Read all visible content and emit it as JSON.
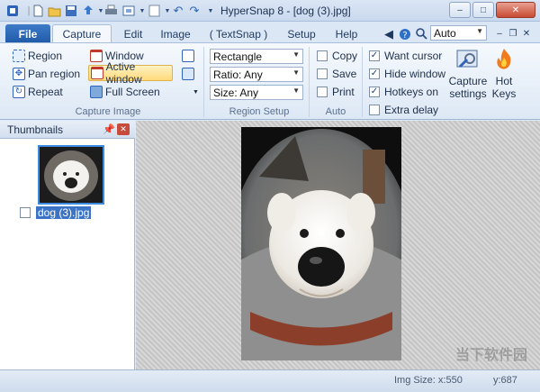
{
  "window": {
    "title": "HyperSnap 8 - [dog (3).jpg]",
    "controls": {
      "minimize": "–",
      "maximize": "□",
      "close": "✕"
    }
  },
  "tabs": [
    {
      "label": "File"
    },
    {
      "label": "Capture"
    },
    {
      "label": "Edit"
    },
    {
      "label": "Image"
    },
    {
      "label": "( TextSnap )"
    },
    {
      "label": "Setup"
    },
    {
      "label": "Help"
    }
  ],
  "zoom_select": {
    "value": "Auto"
  },
  "capture_group": {
    "label": "Capture Image",
    "buttons": [
      {
        "label": "Region"
      },
      {
        "label": "Pan region"
      },
      {
        "label": "Repeat"
      },
      {
        "label": "Window"
      },
      {
        "label": "Active window"
      },
      {
        "label": "Full Screen"
      }
    ]
  },
  "region_setup": {
    "label": "Region Setup",
    "shape": "Rectangle",
    "ratio": "Ratio: Any",
    "size": "Size: Any"
  },
  "auto_group": {
    "label": "Auto",
    "options": [
      {
        "label": "Copy",
        "checked": false
      },
      {
        "label": "Save",
        "checked": false
      },
      {
        "label": "Print",
        "checked": false
      }
    ]
  },
  "cursor_group": {
    "options": [
      {
        "label": "Want cursor",
        "checked": true
      },
      {
        "label": "Hide window",
        "checked": true
      },
      {
        "label": "Hotkeys on",
        "checked": true
      },
      {
        "label": "Extra delay",
        "checked": false
      }
    ]
  },
  "big_buttons": {
    "capture_settings": "Capture settings",
    "hot_keys": "Hot Keys"
  },
  "thumbnails": {
    "title": "Thumbnails",
    "items": [
      {
        "name": "dog (3).jpg"
      }
    ]
  },
  "status": {
    "img_size": "Img Size:  x:550",
    "y": "y:687"
  },
  "watermark": "当下软件园",
  "colors": {
    "accent": "#1f5aa8",
    "highlight": "#ffd97a"
  }
}
